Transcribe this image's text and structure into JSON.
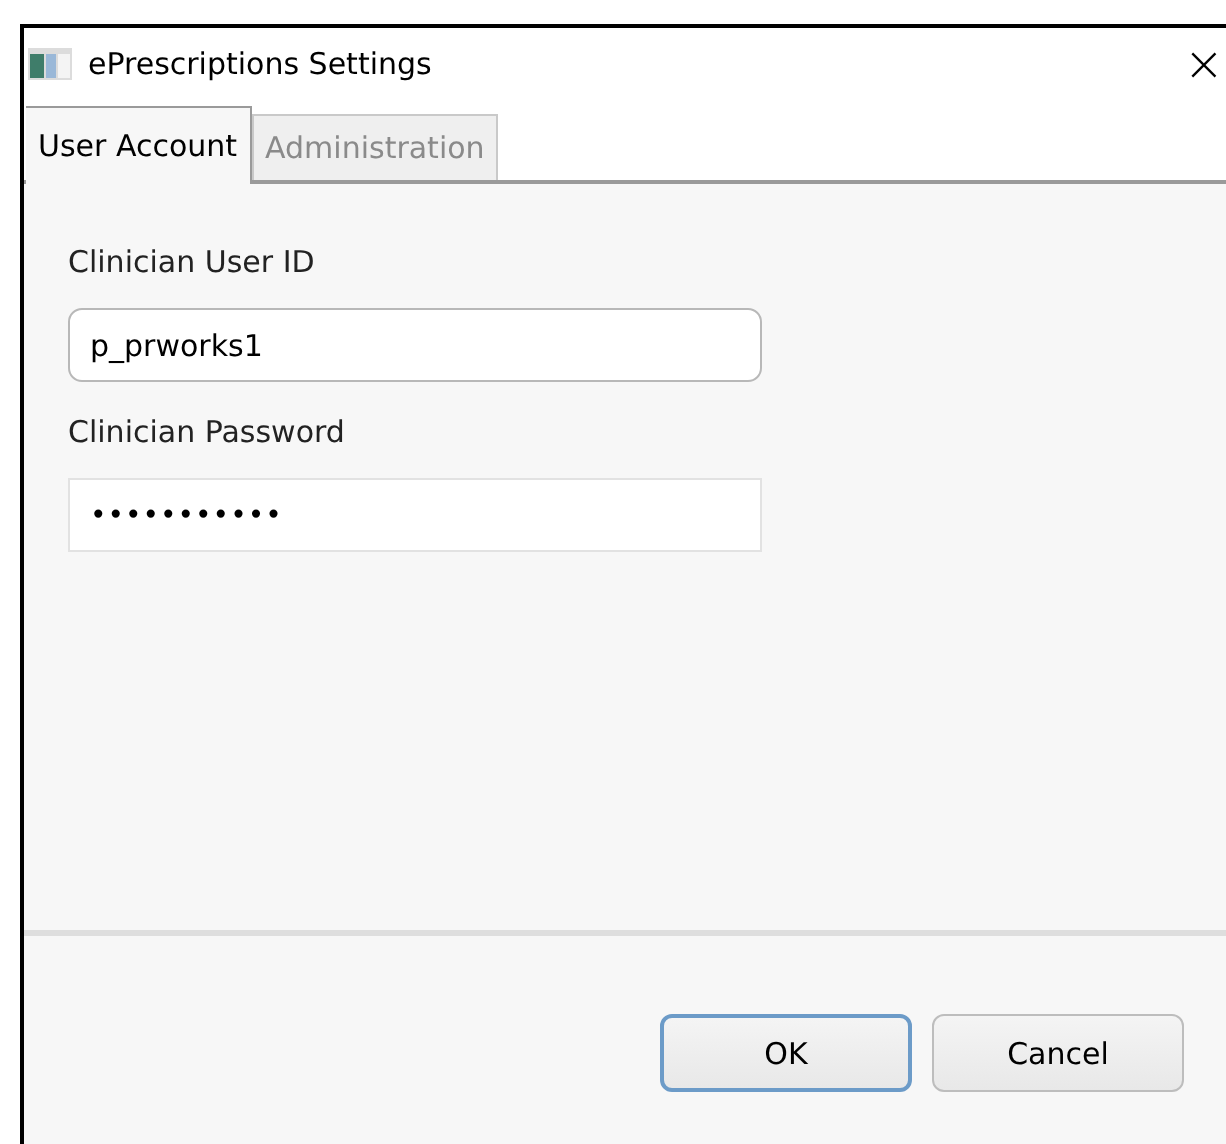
{
  "window": {
    "title": "ePrescriptions Settings",
    "close": "×"
  },
  "tabs": [
    {
      "label": "User Account",
      "selected": true
    },
    {
      "label": "Administration",
      "selected": false
    }
  ],
  "fields": [
    {
      "label": "Clinician User ID",
      "value": "p_prworks1",
      "kind": "text"
    },
    {
      "label": "Clinician Password",
      "value": "•••••••••••",
      "kind": "password"
    }
  ],
  "buttons": [
    {
      "label": "OK",
      "default": true
    },
    {
      "label": "Cancel",
      "default": false
    }
  ]
}
